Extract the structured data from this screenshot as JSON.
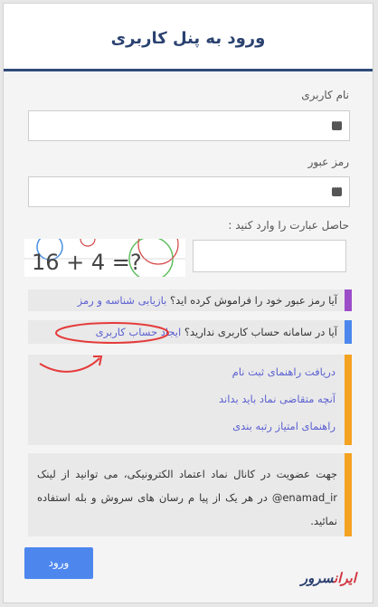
{
  "header": {
    "title": "ورود به پنل کاربری"
  },
  "form": {
    "username_label": "نام کاربری",
    "password_label": "رمز عبور",
    "captcha_label": "حاصل عبارت را وارد کنید :",
    "captcha_text": "16 + 4 =?"
  },
  "forgot": {
    "text": "آیا رمز عبور خود را فراموش کرده اید؟",
    "link": "بازیابی شناسه و رمز",
    "color": "#9b4dc8"
  },
  "register": {
    "text": "آیا در سامانه حساب کاربری ندارید؟",
    "link": "ایجاد حساب کاربری",
    "color": "#4d87ee"
  },
  "guides": {
    "items": [
      "دریافت راهنمای ثبت نام",
      "آنچه متقاضی نماد باید بداند",
      "راهنمای امتیاز رتبه بندی"
    ],
    "color": "#f4a221"
  },
  "notice": {
    "text": "جهت عضویت در کانال نماد اعتماد الکترونیکی، می توانید از لینک enamad_ir@ در هر یک از پیا م رسان های سروش و بله استفاده نمائید."
  },
  "submit_label": "ورود",
  "logo": {
    "part1": "ایران",
    "part2": "سرور"
  }
}
